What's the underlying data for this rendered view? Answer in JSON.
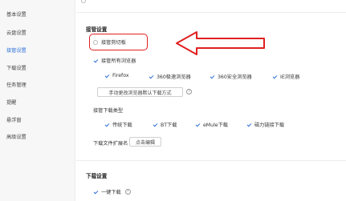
{
  "sidebar": {
    "items": [
      {
        "label": "基本设置"
      },
      {
        "label": "云盘设置"
      },
      {
        "label": "接管设置"
      },
      {
        "label": "下载设置"
      },
      {
        "label": "任务管理"
      },
      {
        "label": "提醒"
      },
      {
        "label": "悬浮窗"
      },
      {
        "label": "高级设置"
      }
    ],
    "active_index": 2
  },
  "takeover": {
    "title": "接管设置",
    "clipboard_label": "接管剪切板",
    "all_browsers_label": "接管所有浏览器",
    "browsers": [
      {
        "label": "Firefox"
      },
      {
        "label": "360极速浏览器"
      },
      {
        "label": "360安全浏览器"
      },
      {
        "label": "IE浏览器"
      }
    ],
    "change_default_button": "手动更改浏览器默认下载方式",
    "download_types_title": "接管下载类型",
    "download_types": [
      {
        "label": "传统下载"
      },
      {
        "label": "BT下载"
      },
      {
        "label": "eMule下载"
      },
      {
        "label": "磁力链接下载"
      }
    ],
    "ext_label": "下载文件扩展名",
    "edit_button": "点击编辑",
    "help_glyph": "?"
  },
  "download": {
    "title": "下载设置",
    "one_click_label": "一键下载",
    "help_glyph": "?"
  },
  "colors": {
    "accent": "#2e70d6",
    "highlight": "#e02020"
  }
}
